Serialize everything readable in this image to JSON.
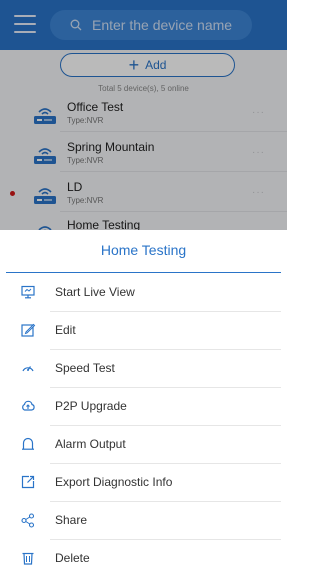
{
  "search": {
    "placeholder": "Enter the device name"
  },
  "add_button": {
    "label": "Add"
  },
  "device_summary": "Total 5 device(s), 5 online",
  "devices": [
    {
      "name": "Office Test",
      "type": "Type:NVR",
      "offline": false
    },
    {
      "name": "Spring Mountain",
      "type": "Type:NVR",
      "offline": false
    },
    {
      "name": "LD",
      "type": "Type:NVR",
      "offline": true
    },
    {
      "name": "Home Testing",
      "type": "",
      "offline": false
    }
  ],
  "sheet": {
    "title": "Home Testing",
    "items": [
      {
        "label": "Start Live View",
        "icon": "monitor-icon"
      },
      {
        "label": "Edit",
        "icon": "edit-icon"
      },
      {
        "label": "Speed Test",
        "icon": "speedometer-icon"
      },
      {
        "label": "P2P Upgrade",
        "icon": "cloud-upload-icon"
      },
      {
        "label": "Alarm Output",
        "icon": "alarm-bell-icon"
      },
      {
        "label": "Export Diagnostic Info",
        "icon": "export-icon"
      },
      {
        "label": "Share",
        "icon": "share-icon"
      },
      {
        "label": "Delete",
        "icon": "trash-icon"
      }
    ]
  },
  "colors": {
    "accent": "#2a74c8",
    "offline_dot": "#d11a1a"
  }
}
